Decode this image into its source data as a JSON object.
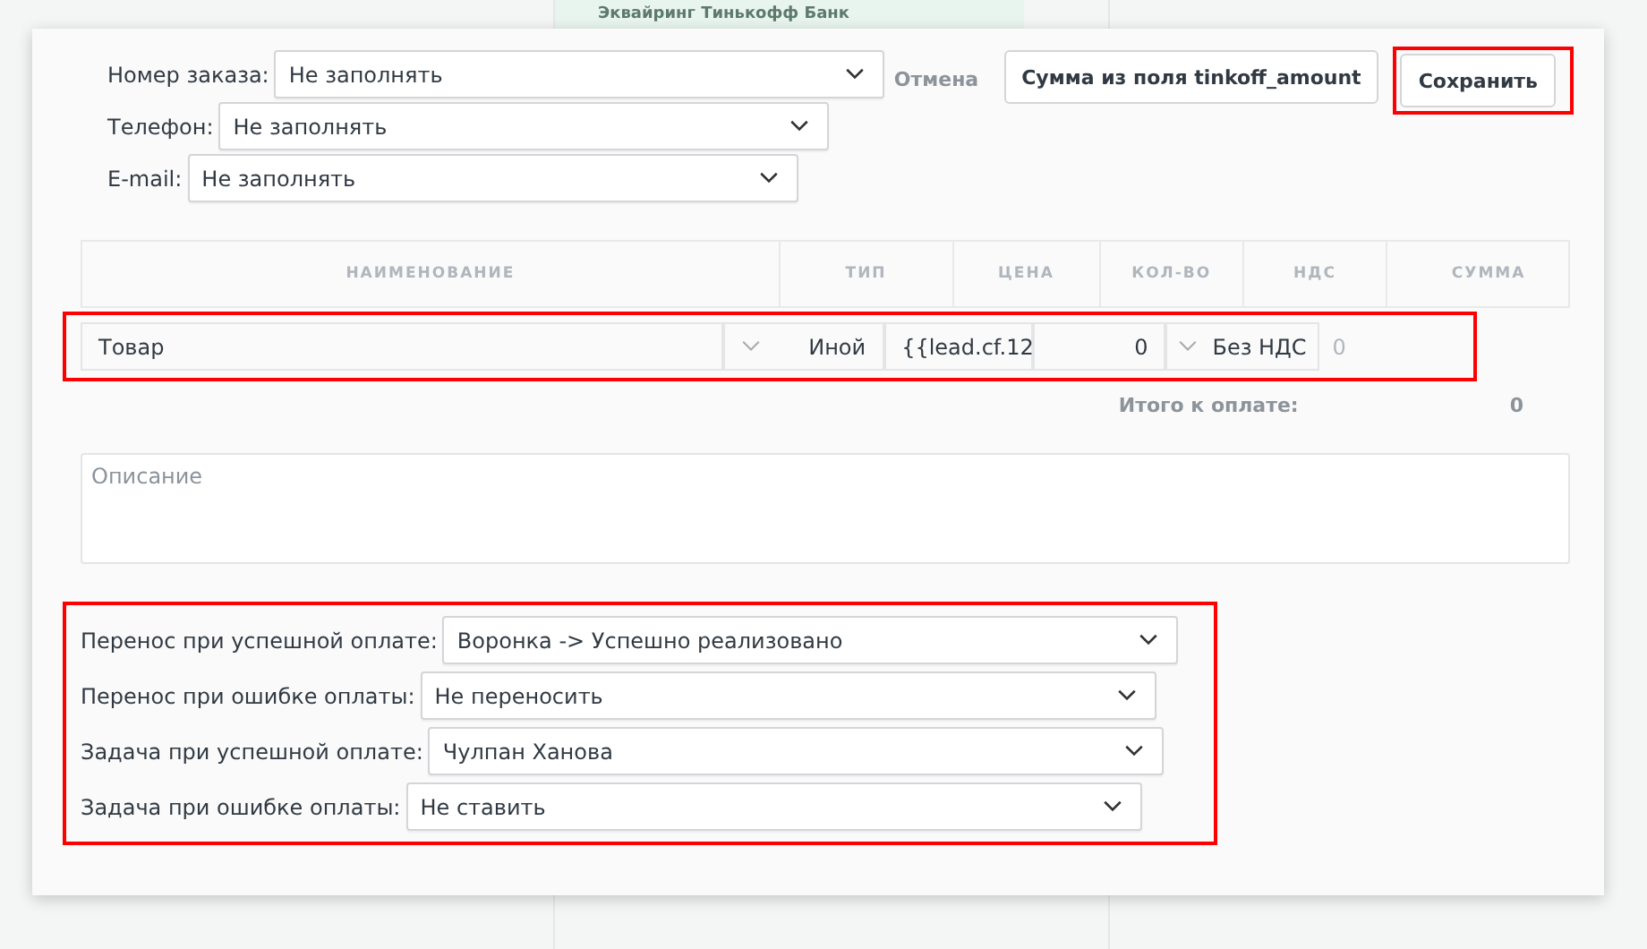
{
  "background": {
    "card_title": "Эквайринг Тинькофф Банк"
  },
  "contact_fields": [
    {
      "label": "Номер заказа:",
      "value": "Не заполнять"
    },
    {
      "label": "Телефон:",
      "value": "Не заполнять"
    },
    {
      "label": "E-mail:",
      "value": "Не заполнять"
    }
  ],
  "actions": {
    "cancel": "Отмена",
    "amount_button": "Сумма из поля tinkoff_amount",
    "save": "Сохранить",
    "save_highlighted": true
  },
  "table": {
    "columns": [
      "НАИМЕНОВАНИЕ",
      "ТИП",
      "ЦЕНА",
      "КОЛ-ВО",
      "НДС",
      "СУММА"
    ],
    "rows": [
      {
        "name": "Товар",
        "type": "Иной",
        "price": "{{lead.cf.12",
        "quantity": "0",
        "vat": "Без НДС",
        "sum": "0",
        "highlighted": true
      }
    ],
    "total_label": "Итого к оплате:",
    "total_value": "0"
  },
  "description": {
    "placeholder": "Описание"
  },
  "transfers_highlighted": true,
  "transfers": [
    {
      "label": "Перенос при успешной оплате:",
      "value": "Воронка -> Успешно реализовано"
    },
    {
      "label": "Перенос при ошибке оплаты:",
      "value": "Не переносить"
    },
    {
      "label": "Задача при успешной оплате:",
      "value": "Чулпан Ханова"
    },
    {
      "label": "Задача при ошибке оплаты:",
      "value": "Не ставить"
    }
  ]
}
